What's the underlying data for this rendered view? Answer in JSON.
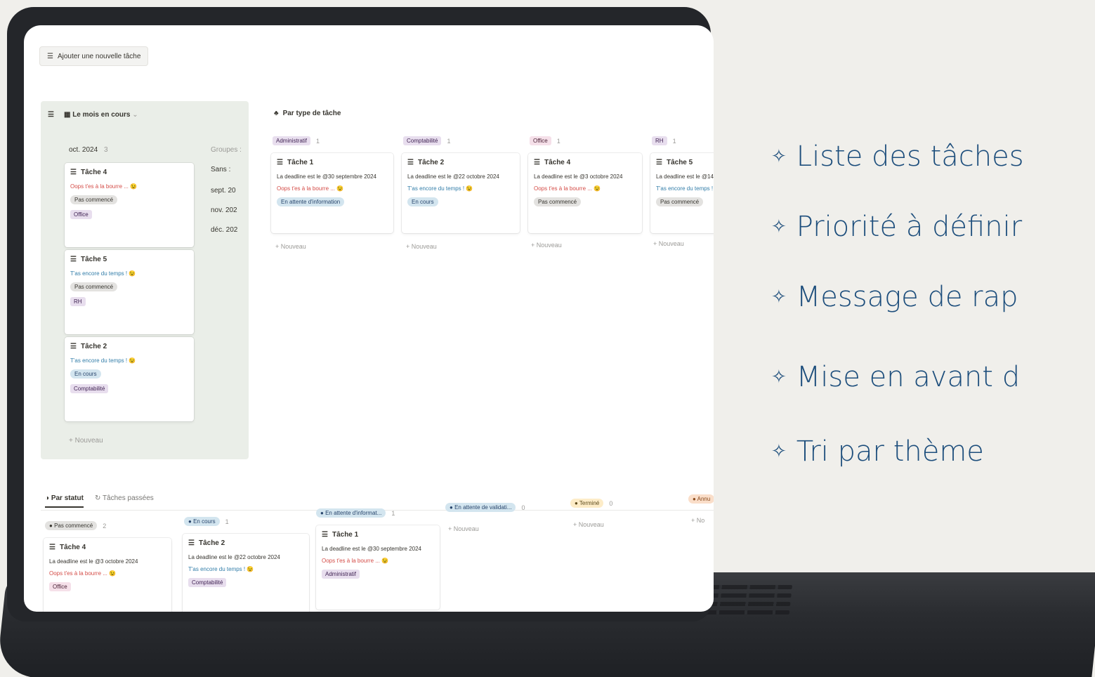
{
  "colors": {
    "background": "#f0efeb",
    "feature_text": "#1d4e7c",
    "laptop": "#24262a"
  },
  "add_task": {
    "icon": "checklist-icon",
    "label": "Ajouter une nouvelle tâche"
  },
  "calendar": {
    "view_label": "Le mois en cours",
    "month": "oct. 2024",
    "month_count": "3",
    "groups_label": "Groupes :",
    "side_items": [
      "Sans :",
      "sept. 20",
      "nov. 202",
      "déc. 202"
    ],
    "cards": [
      {
        "title": "Tâche 4",
        "message": "Oops t'es à la bourre ... 😉",
        "status": "Pas commencé",
        "tag": "Office"
      },
      {
        "title": "Tâche 5",
        "message": "T'as encore du temps ! 😉",
        "status": "Pas commencé",
        "tag": "RH"
      },
      {
        "title": "Tâche 2",
        "message": "T'as encore du temps ! 😉",
        "status": "En cours",
        "tag": "Comptabilité"
      }
    ],
    "new_label": "+ Nouveau"
  },
  "type_board": {
    "title": "Par type de tâche",
    "columns": [
      {
        "name": "Administratif",
        "count": "1",
        "card": {
          "title": "Tâche 1",
          "deadline": "La deadline est le @30 septembre 2024",
          "message": "Oops t'es à la bourre ... 😉",
          "status": "En attente d'information"
        },
        "new_label": "+ Nouveau"
      },
      {
        "name": "Comptabilité",
        "count": "1",
        "card": {
          "title": "Tâche 2",
          "deadline": "La deadline est le @22 octobre 2024",
          "message": "T'as encore du temps ! 😉",
          "status": "En cours"
        },
        "new_label": "+ Nouveau"
      },
      {
        "name": "Office",
        "count": "1",
        "card": {
          "title": "Tâche 4",
          "deadline": "La deadline est le @3 octobre 2024",
          "message": "Oops t'es à la bourre ... 😉",
          "status": "Pas commencé"
        },
        "new_label": "+ Nouveau"
      },
      {
        "name": "RH",
        "count": "1",
        "card": {
          "title": "Tâche 5",
          "deadline": "La deadline est le @14 o",
          "message": "T'as encore du temps !",
          "status": "Pas commencé"
        },
        "new_label": "+ Nouveau"
      }
    ]
  },
  "status_board": {
    "tab_active": "Par statut",
    "tab_other": "Tâches passées",
    "columns": [
      {
        "name": "Pas commencé",
        "count": "2",
        "card": {
          "title": "Tâche 4",
          "deadline": "La deadline est le @3 octobre 2024",
          "message": "Oops t'es à la bourre ... 😉",
          "tag": "Office"
        }
      },
      {
        "name": "En cours",
        "count": "1",
        "card": {
          "title": "Tâche 2",
          "deadline": "La deadline est le @22 octobre 2024",
          "message": "T'as encore du temps ! 😉",
          "tag": "Comptabilité"
        }
      },
      {
        "name": "En attente d'informat...",
        "count": "1",
        "card": {
          "title": "Tâche 1",
          "deadline": "La deadline est le @30 septembre 2024",
          "message": "Oops t'es à la bourre ... 😉",
          "tag": "Administratif"
        }
      },
      {
        "name": "En attente de validati...",
        "count": "0",
        "new_label": "+ Nouveau"
      },
      {
        "name": "Terminé",
        "count": "0",
        "new_label": "+ Nouveau"
      },
      {
        "name": "Annu",
        "new_label": "+ No"
      }
    ]
  },
  "features": [
    {
      "icon": "four-point-star-icon",
      "text": "Liste des tâches"
    },
    {
      "icon": "four-point-star-icon",
      "text": "Priorité à définir"
    },
    {
      "icon": "four-point-star-icon",
      "text": "Message de rap"
    },
    {
      "icon": "four-point-star-icon",
      "text": "Mise en avant d"
    },
    {
      "icon": "four-point-star-icon",
      "text": "Tri par thème"
    }
  ]
}
